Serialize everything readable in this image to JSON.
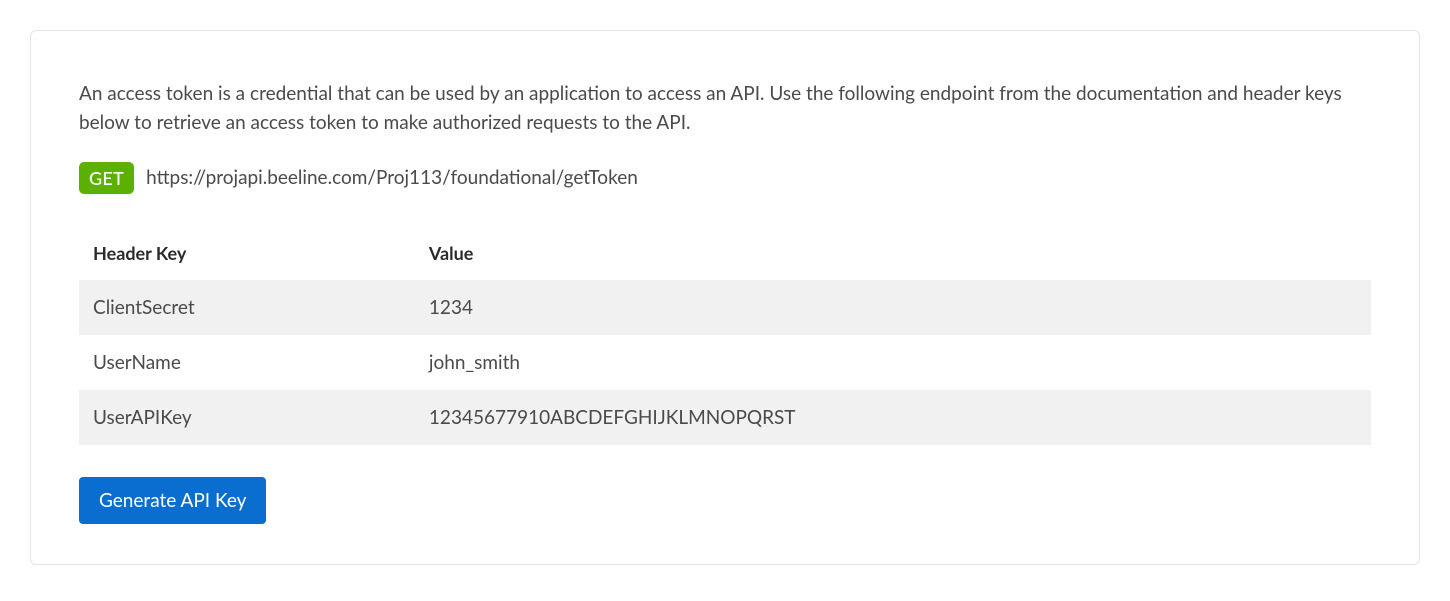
{
  "description": "An access token is a credential that can be used by an application to access an API. Use the following endpoint from the documentation and header keys below to retrieve an access token to make authorized requests to the API.",
  "endpoint": {
    "method": "GET",
    "url": "https://projapi.beeline.com/Proj113/foundational/getToken"
  },
  "table": {
    "headers": {
      "key": "Header Key",
      "value": "Value"
    },
    "rows": [
      {
        "key": "ClientSecret",
        "value": "1234"
      },
      {
        "key": "UserName",
        "value": "john_smith"
      },
      {
        "key": "UserAPIKey",
        "value": "12345677910ABCDEFGHIJKLMNOPQRST"
      }
    ]
  },
  "buttons": {
    "generate": "Generate API Key"
  }
}
